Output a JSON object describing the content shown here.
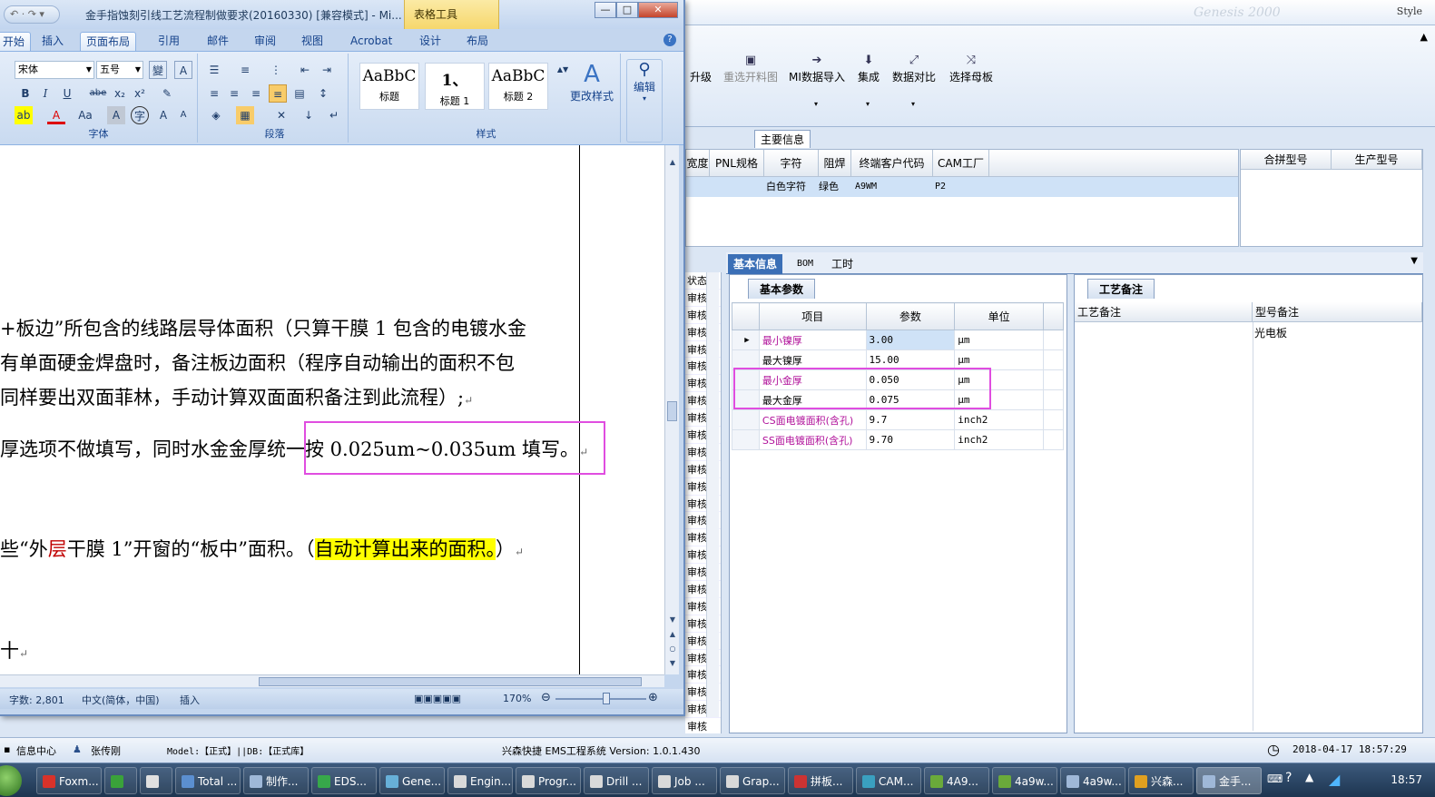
{
  "word": {
    "title": "金手指蚀刻引线工艺流程制做要求(20160330) [兼容模式] - Mi...",
    "table_tools": "表格工具",
    "qat": "↶ · ↷ ▾",
    "window_buttons": {
      "minimize": "—",
      "restore": "□",
      "close": "✕"
    },
    "tabs": [
      "开始",
      "插入",
      "页面布局",
      "引用",
      "邮件",
      "审阅",
      "视图",
      "Acrobat",
      "设计",
      "布局"
    ],
    "active_tab": "开始",
    "font": {
      "name": "宋体",
      "size": "五号"
    },
    "format_buttons": [
      "B",
      "I",
      "U",
      "abe",
      "x₂",
      "x²",
      "A",
      "Aa",
      "A",
      "A",
      "A"
    ],
    "groups": {
      "font": "字体",
      "paragraph": "段落",
      "styles": "样式"
    },
    "styles": [
      {
        "preview": "AaBbC",
        "name": "标题"
      },
      {
        "preview": "1、",
        "name": "标题 1"
      },
      {
        "preview": "AaBbC",
        "name": "标题 2"
      }
    ],
    "change_styles": "更改样式",
    "edit": "编辑",
    "document_lines": [
      "+板边”所包含的线路层导体面积（只算干膜 1 包含的电镀水金",
      "有单面硬金焊盘时，备注板边面积（程序自动输出的面积不包",
      "同样要出双面菲林，手动计算双面面积备注到此流程）;",
      "厚选项不做填写，同时水金金厚统一按 0.025um~0.035um 填写。",
      "",
      "十"
    ],
    "line5": {
      "pre": "些“外",
      "red": "层",
      "mid": "干膜 1”开窗的“板中”面积。（",
      "yellow": "自动计算出来的面积。",
      "post": "）"
    },
    "paragraph_mark": "↵",
    "status": {
      "words": "字数: 2,801",
      "language": "中文(简体，中国)",
      "mode": "插入",
      "zoom": "170%"
    }
  },
  "ems": {
    "style_label": "Style",
    "watermark": "Genesis 2000",
    "toolbar": [
      {
        "label": "升级",
        "icon": "",
        "disabled": false
      },
      {
        "label": "重选开料图",
        "icon": "▣",
        "disabled": true
      },
      {
        "label": "MI数据导入",
        "icon": "➔",
        "disabled": false
      },
      {
        "label": "集成",
        "icon": "⬇",
        "disabled": false
      },
      {
        "label": "数据对比",
        "icon": "⤢",
        "disabled": false
      },
      {
        "label": "选择母板",
        "icon": "⤨",
        "disabled": false
      }
    ],
    "main_info_tab": "主要信息",
    "grid_columns": [
      "宽度",
      "PNL规格",
      "字符",
      "阻焊",
      "终端客户代码",
      "CAM工厂"
    ],
    "grid_row": {
      "char": "白色字符",
      "mask": "绿色",
      "customer": "A9WM",
      "factory": "P2"
    },
    "right_grid_columns": [
      "合拼型号",
      "生产型号"
    ],
    "tabs": [
      "基本信息",
      "BOM",
      "工时"
    ],
    "left_column_header": "状态",
    "left_column_value": "审核",
    "basic_params_tab": "基本参数",
    "param_columns": [
      "项目",
      "参数",
      "单位"
    ],
    "params": [
      {
        "name": "最小镍厚",
        "value": "3.00",
        "unit": "μm",
        "magenta": true
      },
      {
        "name": "最大镍厚",
        "value": "15.00",
        "unit": "μm",
        "magenta": false
      },
      {
        "name": "最小金厚",
        "value": "0.050",
        "unit": "μm",
        "magenta": true
      },
      {
        "name": "最大金厚",
        "value": "0.075",
        "unit": "μm",
        "magenta": false
      },
      {
        "name": "CS面电镀面积(含孔)",
        "value": "9.7",
        "unit": "inch2",
        "magenta": true
      },
      {
        "name": "SS面电镀面积(含孔)",
        "value": "9.70",
        "unit": "inch2",
        "magenta": true
      }
    ],
    "process_notes_tab": "工艺备注",
    "note_columns": [
      "工艺备注",
      "型号备注"
    ],
    "model_note": "光电板",
    "status": {
      "info_center": "信息中心",
      "user": "张传刚",
      "model": "Model:【正式】||DB:【正式库】",
      "system": "兴森快捷 EMS工程系统  Version: 1.0.1.430",
      "datetime": "2018-04-17 18:57:29"
    }
  },
  "taskbar": {
    "items": [
      "Foxm...",
      "",
      "",
      "Total ...",
      "制作...",
      "EDS...",
      "Gene...",
      "Engin...",
      "Progr...",
      "Drill ...",
      "Job ...",
      "Grap...",
      "拼板...",
      "CAM...",
      "4A9...",
      "4a9w...",
      "4a9w...",
      "兴森...",
      "金手..."
    ],
    "clock": "18:57"
  },
  "colors": {
    "magenta_box": "#e04de0",
    "yellow_highlight": "#ffff00",
    "tab_active": "#3b6fb6"
  }
}
